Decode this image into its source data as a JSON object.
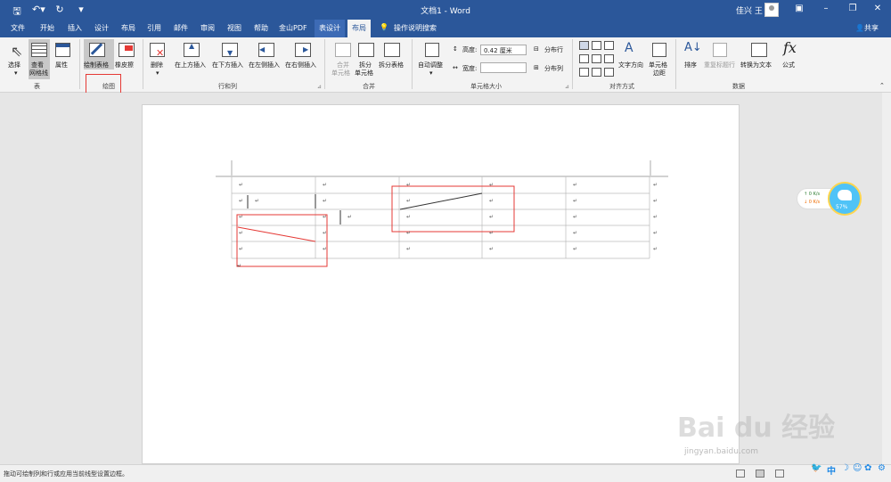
{
  "title": {
    "window_title": "文档1 - Word",
    "user": "佳兴 王",
    "qat_icons": [
      "save-icon",
      "undo-icon",
      "redo-icon",
      "customize-icon"
    ]
  },
  "tabs": {
    "file": "文件",
    "home": "开始",
    "insert": "插入",
    "design": "设计",
    "layout": "布局",
    "references": "引用",
    "mailings": "邮件",
    "review": "审阅",
    "view": "视图",
    "help": "帮助",
    "wps_pdf": "金山PDF",
    "table_design": "表设计",
    "table_layout": "布局",
    "tell_me": "操作说明搜索",
    "share": "共享"
  },
  "ribbon": {
    "table": {
      "select": "选择",
      "gridlines_1": "查看",
      "gridlines_2": "网格线",
      "properties": "属性",
      "group": "表"
    },
    "draw": {
      "draw_table": "绘制表格",
      "eraser": "橡皮擦",
      "group": "绘图"
    },
    "rows_cols": {
      "delete": "删除",
      "insert_above": "在上方插入",
      "insert_below": "在下方插入",
      "insert_left": "在左侧插入",
      "insert_right": "在右侧插入",
      "group": "行和列"
    },
    "merge": {
      "merge_1": "合并",
      "merge_2": "单元格",
      "split_cells_1": "拆分",
      "split_cells_2": "单元格",
      "split_table": "拆分表格",
      "group": "合并"
    },
    "cell_size": {
      "autofit": "自动调整",
      "height_label": "高度:",
      "height_value": "0.42 厘米",
      "width_label": "宽度:",
      "width_value": "",
      "distribute_rows": "分布行",
      "distribute_cols": "分布列",
      "group": "单元格大小"
    },
    "alignment": {
      "text_direction": "文字方向",
      "cell_margins_1": "单元格",
      "cell_margins_2": "边距",
      "group": "对齐方式"
    },
    "data": {
      "sort": "排序",
      "repeat_header": "重复标题行",
      "convert_text": "转换为文本",
      "formula_icon": "fx",
      "formula": "公式",
      "group": "数据"
    }
  },
  "table": {
    "rows": 5,
    "cols": 5,
    "cell_mark": "↵"
  },
  "network": {
    "up": "0",
    "up_unit": "K/s",
    "down": "0",
    "down_unit": "K/s",
    "percent": "57%"
  },
  "status": {
    "text": "拖动可绘制列和行或应用当前线型设置边框。"
  },
  "watermark": {
    "brand": "Bai du 经验",
    "url": "jingyan.baidu.com"
  },
  "tray": {
    "ime": "中"
  },
  "colors": {
    "accent": "#2b579a",
    "highlight": "#e53935"
  }
}
